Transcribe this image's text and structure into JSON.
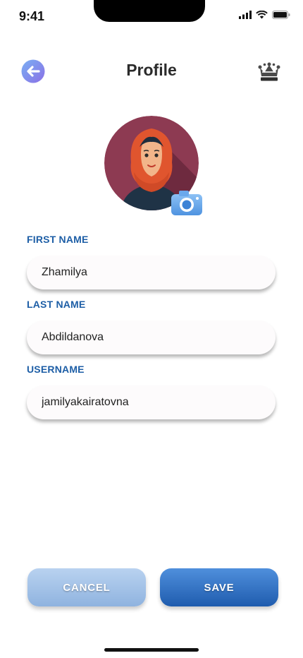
{
  "status_bar": {
    "time": "9:41"
  },
  "header": {
    "title": "Profile",
    "back_icon": "back-arrow-icon",
    "premium_icon": "crown-icon"
  },
  "colors": {
    "label": "#1d5ea6",
    "save_button": "#2a6bc0",
    "cancel_button": "#a3c2e8",
    "avatar_bg": "#8d3a52"
  },
  "form": {
    "first_name": {
      "label": "FIRST NAME",
      "value": "Zhamilya"
    },
    "last_name": {
      "label": "LAST NAME",
      "value": "Abdildanova"
    },
    "username": {
      "label": "USERNAME",
      "value": "jamilyakairatovna"
    }
  },
  "actions": {
    "cancel_label": "CANCEL",
    "save_label": "SAVE"
  }
}
